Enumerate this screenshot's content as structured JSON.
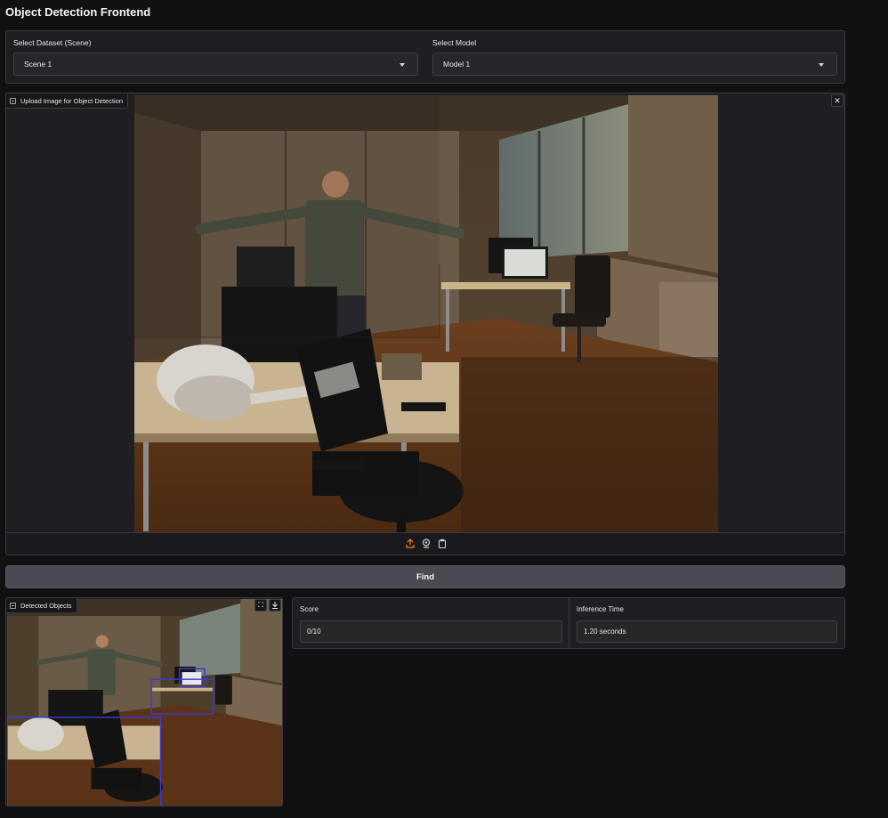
{
  "app": {
    "title": "Object Detection Frontend"
  },
  "dataset": {
    "label": "Select Dataset (Scene)",
    "value": "Scene 1"
  },
  "model": {
    "label": "Select Model",
    "value": "Model 1"
  },
  "upload": {
    "label": "Upload Image for Object Detection",
    "close_icon": "close-icon"
  },
  "toolbar": {
    "icons": [
      "upload-icon",
      "webcam-icon",
      "clipboard-icon"
    ]
  },
  "find": {
    "label": "Find"
  },
  "detected": {
    "label": "Detected Objects",
    "icons": [
      "fullscreen-icon",
      "download-icon"
    ]
  },
  "score": {
    "label": "Score",
    "value": "0/10"
  },
  "inference": {
    "label": "Inference Time",
    "value": "1.20 seconds"
  },
  "colors": {
    "background": "#111113",
    "panel": "#1f1f23",
    "button": "#4a4a52",
    "accent_icon": "#f97316",
    "box_blue": "#3b3bd6"
  }
}
